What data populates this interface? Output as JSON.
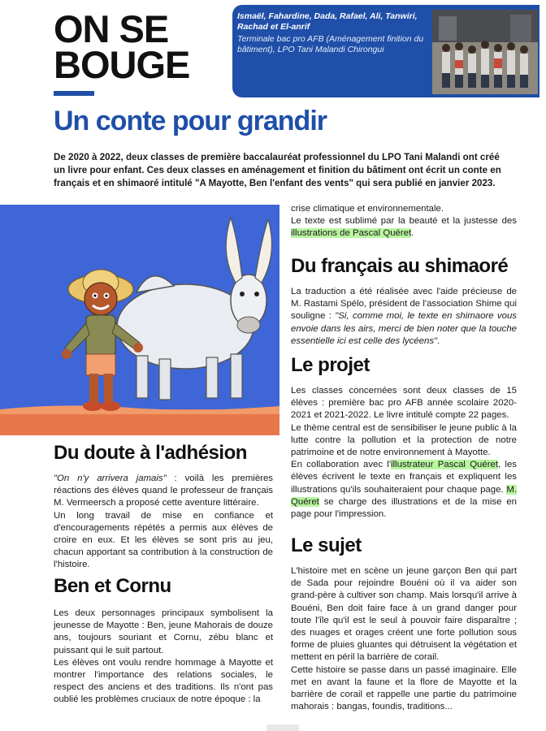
{
  "masthead": {
    "line1": "ON SE",
    "line2": "BOUGE"
  },
  "credit": {
    "names": "Ismaël, Fahardine, Dada, Rafael, Ali, Tanwiri, Rachad et El-anrif",
    "class": "Terminale bac pro AFB (Aménagement finition du bâtiment), LPO Tani Malandi Chirongui"
  },
  "headline": "Un conte pour grandir",
  "intro": "De 2020 à 2022, deux classes de première baccalauréat professionnel du LPO Tani Malandi ont créé un livre pour enfant. Ces deux classes en aménagement et finition du bâtiment ont écrit un conte en français et en shimaoré intitulé \"A Mayotte, Ben l'enfant des vents\" qui sera publié en janvier 2023.",
  "sections": {
    "doute": {
      "title": "Du doute à l'adhésion",
      "quote": "\"On n'y arrivera jamais\"",
      "p1_rest": " : voilà les premières réactions des élèves quand le professeur de français M. Vermeersch a proposé cette aventure littéraire.",
      "p2": "Un long travail de mise en confiance et d'encouragements répétés a permis aux élèves de croire en eux. Et les élèves se sont pris au jeu, chacun apportant sa contribution à la construction de l'histoire."
    },
    "ben": {
      "title": "Ben et Cornu",
      "p1": "Les deux personnages principaux symbolisent la jeunesse de Mayotte : Ben, jeune Mahorais de douze ans, toujours souriant et Cornu, zébu blanc et puissant qui le suit partout.",
      "p2": "Les élèves ont voulu rendre hommage à Mayotte et montrer l'importance des relations sociales, le respect des anciens et des traditions. Ils n'ont pas oublié les problèmes cruciaux de notre époque : la"
    },
    "top": {
      "l1": "crise climatique et environnementale.",
      "l2": "Le texte est sublimé par la beauté et la justesse des ",
      "l2_hl": "illustrations de Pascal Quéret",
      "l2_end": "."
    },
    "shimaore": {
      "title": "Du français au shimaoré",
      "p1_start": "La traduction a été réalisée avec l'aide précieuse de M. Rastami Spélo, président de l'association Shime qui souligne : ",
      "p1_quote": "\"Si, comme moi, le texte en shimaore vous envoie dans les airs, merci de bien noter que la touche essentielle ici est celle des lycéens\"",
      "p1_end": "."
    },
    "projet": {
      "title": "Le projet",
      "p1": "Les classes concernées sont deux classes de 15 élèves : première bac pro AFB année scolaire 2020-2021 et 2021-2022. Le livre intitulé compte 22 pages.",
      "p2": "Le thème central est de sensibiliser le jeune public à la lutte contre la pollution et la protection de notre patrimoine et de notre environnement à Mayotte.",
      "p3_start": "En collaboration avec l'",
      "p3_hl1": "illustrateur Pascal Quéret",
      "p3_mid": ", les élèves écrivent le texte en français et expliquent les illustrations qu'ils souhaiteraient pour chaque page. ",
      "p3_hl2": "M. Quéret",
      "p3_end": " se charge des illustrations et de la mise en page pour l'impression."
    },
    "sujet": {
      "title": "Le sujet",
      "p1": "L'histoire met en scène un jeune garçon Ben qui part de Sada pour rejoindre Bouéni où il va aider son grand-père à cultiver son champ. Mais lorsqu'il arrive à Bouéni, Ben doit faire face à un grand danger pour toute l'île qu'il est le seul à pouvoir faire disparaître ; des nuages et orages créent une forte pollution sous forme de pluies gluantes qui détruisent la végétation et mettent en péril la barrière de corail.",
      "p2": "Cette histoire se passe dans un passé imaginaire. Elle met en avant la faune et la flore de Mayotte et la barrière de corail et rappelle une partie du patrimoine mahorais : bangas, foundis, traditions..."
    }
  },
  "colors": {
    "accent": "#1f4fa8",
    "highlight": "#b8f5a0",
    "illustration_bg": "#3f66d6"
  },
  "illustration": {
    "subject": "boy-and-zebu-illustration"
  },
  "photo": {
    "subject": "class-group-photo"
  }
}
